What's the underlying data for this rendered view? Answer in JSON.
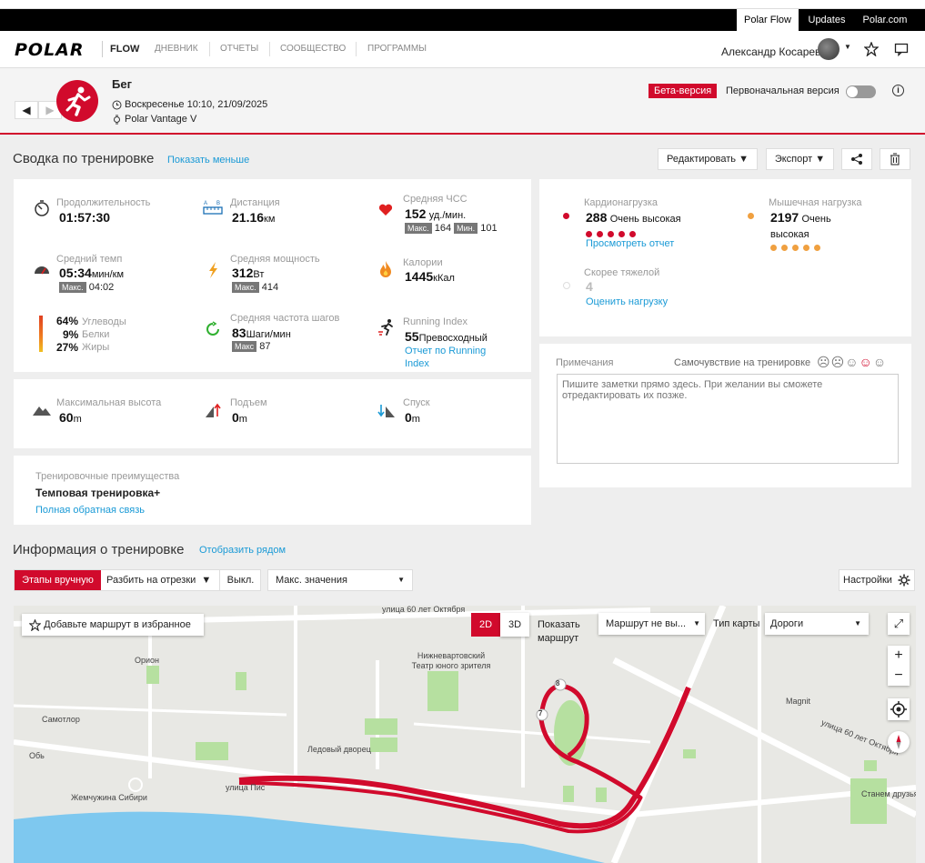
{
  "topbar": {
    "tabs": [
      "Polar Flow",
      "Updates",
      "Polar.com"
    ]
  },
  "nav": {
    "logo": "POLAR",
    "flow": "FLOW",
    "links": [
      "ДНЕВНИК",
      "ОТЧЕТЫ",
      "СООБЩЕСТВО",
      "ПРОГРАММЫ"
    ],
    "user": "Александр Косарев"
  },
  "header": {
    "sport": "Бег",
    "datetime": "Воскресенье 10:10, 21/09/2025",
    "device": "Polar Vantage V",
    "beta": "Бета-версия",
    "original_version": "Первоначальная версия"
  },
  "summary": {
    "title": "Сводка по тренировке",
    "show_less": "Показать меньше",
    "edit": "Редактировать",
    "export": "Экспорт",
    "duration": {
      "label": "Продолжительность",
      "value": "01:57:30"
    },
    "distance": {
      "label": "Дистанция",
      "value": "21.16",
      "unit": "км"
    },
    "hr": {
      "label": "Средняя ЧСС",
      "value": "152",
      "unit": "уд./мин.",
      "max_label": "Макс.",
      "max": "164",
      "min_label": "Мин.",
      "min": "101"
    },
    "pace": {
      "label": "Средний темп",
      "value": "05:34",
      "unit": "мин/км",
      "max_label": "Макс.",
      "max": "04:02"
    },
    "power": {
      "label": "Средняя мощность",
      "value": "312",
      "unit": "Вт",
      "max_label": "Макс.",
      "max": "414"
    },
    "calories": {
      "label": "Калории",
      "value": "1445",
      "unit": "кКал"
    },
    "fuel": [
      {
        "pct": "64%",
        "label": "Углеводы"
      },
      {
        "pct": "9%",
        "label": "Белки"
      },
      {
        "pct": "27%",
        "label": "Жиры"
      }
    ],
    "cadence": {
      "label": "Средняя частота шагов",
      "value": "83",
      "unit": "Шаги/мин",
      "max_label": "Макс",
      "max": "87"
    },
    "running_index": {
      "label": "Running Index",
      "value": "55",
      "desc": "Превосходный",
      "link": "Отчет по Running Index"
    },
    "max_alt": {
      "label": "Максимальная высота",
      "value": "60",
      "unit": "m"
    },
    "ascent": {
      "label": "Подъем",
      "value": "0",
      "unit": "m"
    },
    "descent": {
      "label": "Спуск",
      "value": "0",
      "unit": "m"
    },
    "benefit": {
      "label": "Тренировочные преимущества",
      "value": "Темповая тренировка+",
      "link": "Полная обратная связь"
    },
    "cardio": {
      "label": "Кардионагрузка",
      "value": "288",
      "desc": "Очень высокая",
      "dots": 5,
      "link": "Просмотреть отчет"
    },
    "muscle": {
      "label": "Мышечная нагрузка",
      "value": "2197",
      "desc": "Очень высокая",
      "dots": 5
    },
    "perceived": {
      "label": "Скорее тяжелой",
      "value": "4",
      "link": "Оценить нагрузку"
    },
    "notes": {
      "label": "Примечания",
      "feeling": "Самочувствие на тренировке",
      "placeholder": "Пишите заметки прямо здесь. При желании вы сможете отредактировать их позже."
    }
  },
  "training_info": {
    "title": "Информация о тренировке",
    "side_by_side": "Отобразить рядом",
    "laps_manual": "Этапы вручную",
    "split": "Разбить на отрезки",
    "off": "Выкл.",
    "max_values": "Макс. значения",
    "settings": "Настройки"
  },
  "map": {
    "add_fav": "Добавьте маршрут в избранное",
    "btn_2d": "2D",
    "btn_3d": "3D",
    "show_route": "Показать маршрут",
    "route_select": "Маршрут не вы...",
    "map_type_label": "Тип карты",
    "map_type": "Дороги",
    "labels": {
      "street_top": "улица 60 лет Октября",
      "orion": "Орион",
      "theater": "Нижневартовский Театр юного зрителя",
      "samotlor": "Самотлор",
      "ob": "Обь",
      "ice": "Ледовый дворец",
      "pearl": "Жемчужина Сибири",
      "street_pis": "улица Пис",
      "magnit": "Magnit",
      "street_right": "улица 60 лет Октября",
      "stanem": "Станем друзья"
    },
    "markers": [
      "8",
      "7"
    ]
  }
}
